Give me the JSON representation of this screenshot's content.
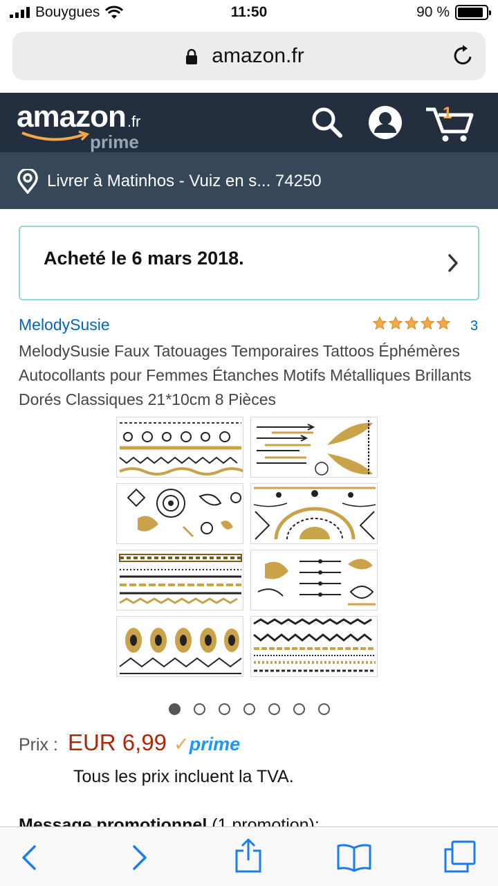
{
  "status_bar": {
    "carrier": "Bouygues",
    "time": "11:50",
    "battery_text": "90 %",
    "battery_level": 0.9
  },
  "browser": {
    "url": "amazon.fr"
  },
  "header": {
    "logo_word": "amazon",
    "logo_tld": ".fr",
    "logo_prime": "prime",
    "cart_count": "1",
    "brand_color": "#232f3e",
    "accent_color": "#f3a847"
  },
  "deliver": {
    "text": "Livrer à Matinhos - Vuiz en s... 74250"
  },
  "purchase_notice": {
    "text": "Acheté le 6 mars 2018."
  },
  "product": {
    "brand": "MelodySusie",
    "rating": 5,
    "review_count": "3",
    "title": "MelodySusie Faux Tatouages Temporaires Tattoos Éphémères Autocollants pour Femmes Étanches Motifs Métalliques Brillants Dorés Classiques 21*10cm 8 Pièces",
    "image_count": 7,
    "active_image": 1
  },
  "price": {
    "label": "Prix :",
    "value": "EUR 6,99",
    "prime_label": "prime",
    "tax_note": "Tous les prix incluent la TVA."
  },
  "promotion": {
    "heading_bold": "Message promotionnel",
    "heading_rest": " (1 promotion):"
  },
  "icons": {
    "lock": "lock-icon",
    "reload": "reload-icon",
    "search": "search-icon",
    "account": "account-icon",
    "cart": "cart-icon",
    "location": "location-pin-icon",
    "back": "back-icon",
    "forward": "forward-icon",
    "share": "share-icon",
    "bookmarks": "bookmarks-icon",
    "tabs": "tabs-icon"
  }
}
